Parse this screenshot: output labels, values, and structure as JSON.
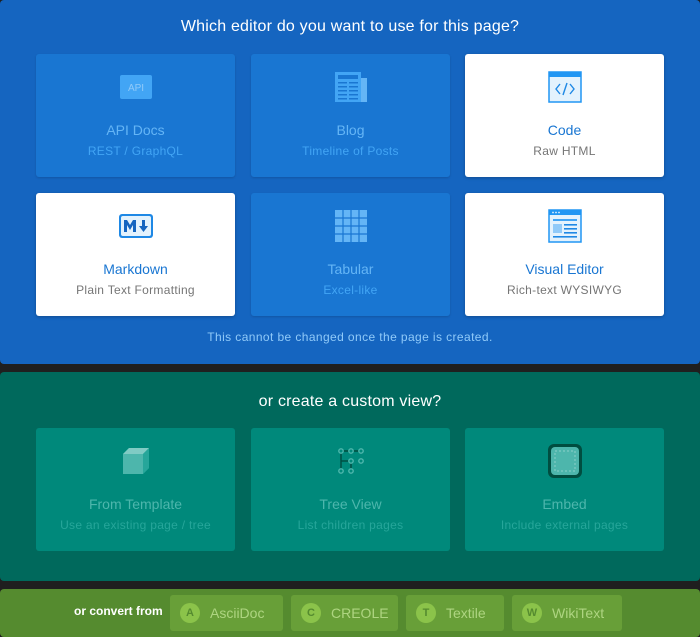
{
  "editor_section": {
    "title": "Which editor do you want to use for this page?",
    "note": "This cannot be changed once the page is created.",
    "cards": [
      {
        "title": "API Docs",
        "subtitle": "REST / GraphQL",
        "icon": "api-icon",
        "enabled": false
      },
      {
        "title": "Blog",
        "subtitle": "Timeline of Posts",
        "icon": "newspaper-icon",
        "enabled": false
      },
      {
        "title": "Code",
        "subtitle": "Raw HTML",
        "icon": "code-window-icon",
        "enabled": true
      },
      {
        "title": "Markdown",
        "subtitle": "Plain Text Formatting",
        "icon": "markdown-icon",
        "enabled": true
      },
      {
        "title": "Tabular",
        "subtitle": "Excel-like",
        "icon": "grid-table-icon",
        "enabled": false
      },
      {
        "title": "Visual Editor",
        "subtitle": "Rich-text WYSIWYG",
        "icon": "visual-editor-icon",
        "enabled": true
      }
    ]
  },
  "custom_section": {
    "title": "or create a custom view?",
    "cards": [
      {
        "title": "From Template",
        "subtitle": "Use an existing page / tree",
        "icon": "cube-icon",
        "enabled": false
      },
      {
        "title": "Tree View",
        "subtitle": "List children pages",
        "icon": "tree-structure-icon",
        "enabled": false
      },
      {
        "title": "Embed",
        "subtitle": "Include external pages",
        "icon": "embed-icon",
        "enabled": false
      }
    ]
  },
  "convert_section": {
    "label": "or convert from",
    "options": [
      {
        "letter": "A",
        "label": "AsciiDoc"
      },
      {
        "letter": "C",
        "label": "CREOLE"
      },
      {
        "letter": "T",
        "label": "Textile"
      },
      {
        "letter": "W",
        "label": "WikiText"
      }
    ]
  },
  "colors": {
    "editor_bg": "#1565c0",
    "custom_bg": "#00695c",
    "convert_bg": "#558b2f",
    "accent": "#1976d2"
  }
}
